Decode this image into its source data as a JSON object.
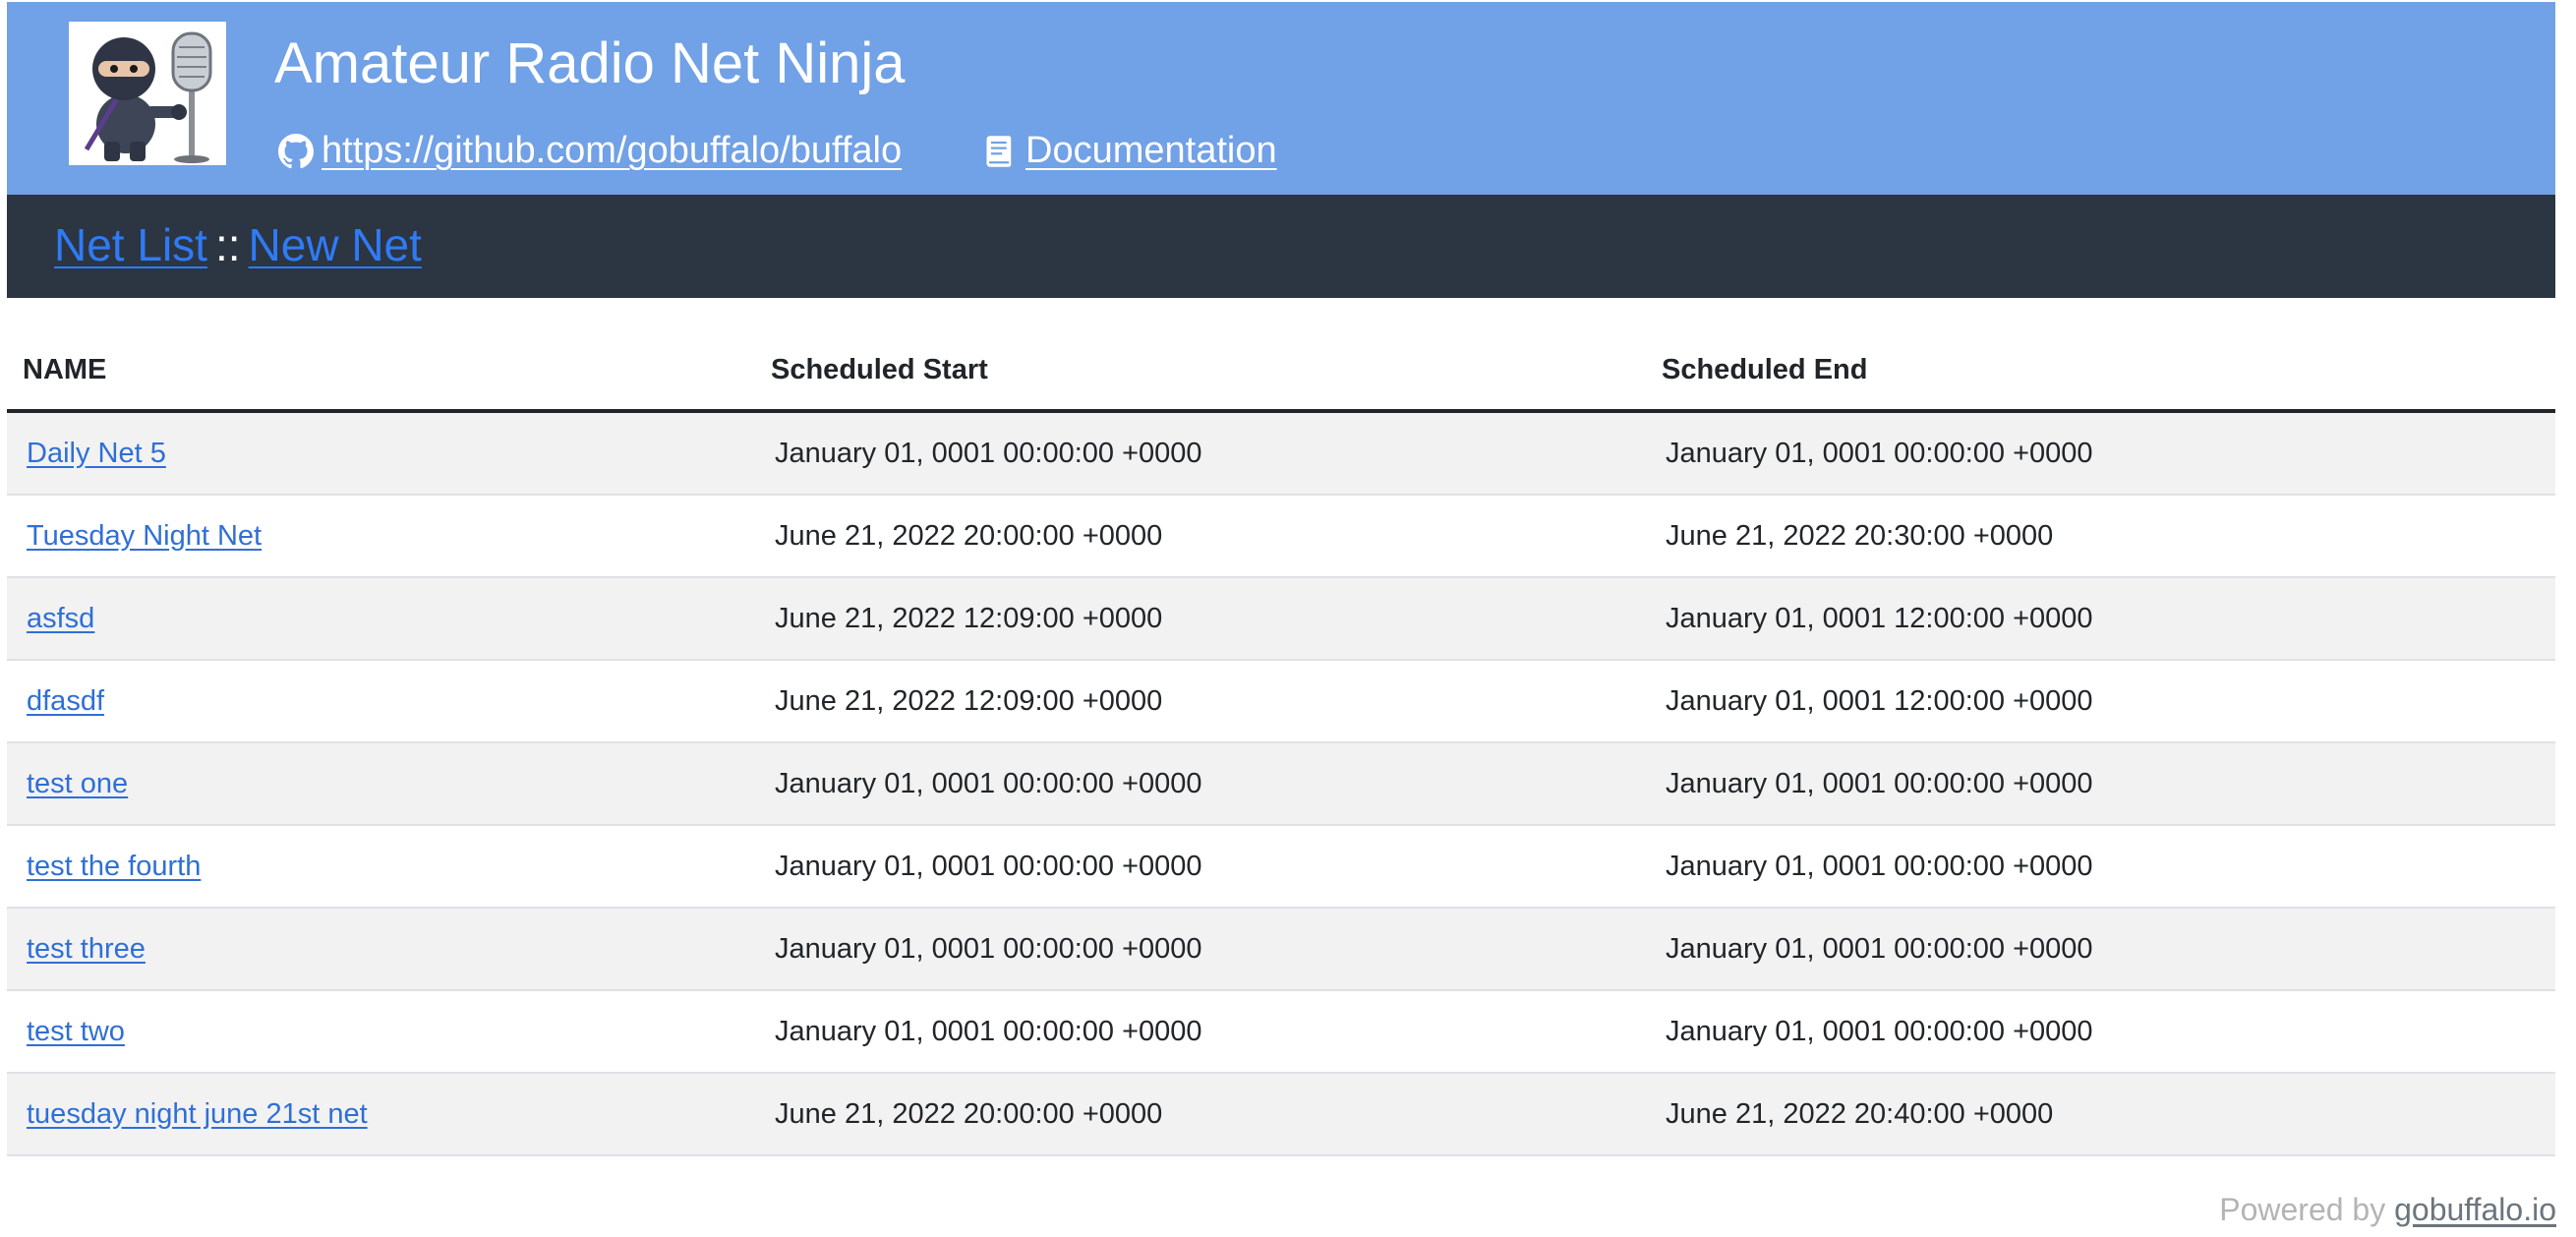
{
  "header": {
    "title": "Amateur Radio Net Ninja",
    "logo": "ninja-microphone-logo",
    "links": {
      "repo_label": " https://github.com/gobuffalo/buffalo",
      "repo_icon": "github-icon",
      "docs_label": " Documentation",
      "docs_icon": "book-icon"
    }
  },
  "nav": {
    "net_list": "Net List",
    "separator": "::",
    "new_net": "New Net"
  },
  "table": {
    "columns": [
      "NAME",
      "Scheduled Start",
      "Scheduled End"
    ],
    "rows": [
      {
        "name": "Daily Net 5",
        "start": "January 01, 0001 00:00:00 +0000",
        "end": "January 01, 0001 00:00:00 +0000"
      },
      {
        "name": "Tuesday Night Net",
        "start": "June 21, 2022 20:00:00 +0000",
        "end": "June 21, 2022 20:30:00 +0000"
      },
      {
        "name": "asfsd",
        "start": "June 21, 2022 12:09:00 +0000",
        "end": "January 01, 0001 12:00:00 +0000"
      },
      {
        "name": "dfasdf",
        "start": "June 21, 2022 12:09:00 +0000",
        "end": "January 01, 0001 12:00:00 +0000"
      },
      {
        "name": "test one",
        "start": "January 01, 0001 00:00:00 +0000",
        "end": "January 01, 0001 00:00:00 +0000"
      },
      {
        "name": "test the fourth",
        "start": "January 01, 0001 00:00:00 +0000",
        "end": "January 01, 0001 00:00:00 +0000"
      },
      {
        "name": "test three",
        "start": "January 01, 0001 00:00:00 +0000",
        "end": "January 01, 0001 00:00:00 +0000"
      },
      {
        "name": "test two",
        "start": "January 01, 0001 00:00:00 +0000",
        "end": "January 01, 0001 00:00:00 +0000"
      },
      {
        "name": "tuesday night june 21st net",
        "start": "June 21, 2022 20:00:00 +0000",
        "end": "June 21, 2022 20:40:00 +0000"
      }
    ]
  },
  "footer": {
    "prefix": "Powered by ",
    "link": "gobuffalo.io"
  },
  "colors": {
    "header_bg": "#71a1e6",
    "nav_bg": "#2c3542",
    "link": "#2f6fd6",
    "row_stripe": "#f2f2f2"
  }
}
